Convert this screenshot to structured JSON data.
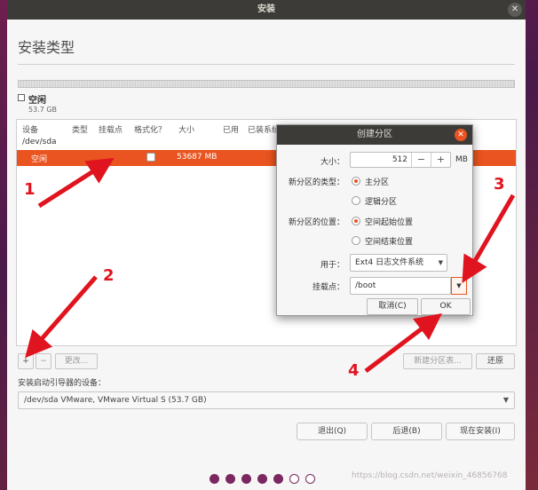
{
  "window": {
    "title": "安装",
    "close_glyph": "✕"
  },
  "page": {
    "title": "安装类型"
  },
  "legend": {
    "label": "空闲",
    "size": "53.7 GB"
  },
  "table": {
    "headers": [
      "设备",
      "类型",
      "挂载点",
      "格式化？",
      "大小",
      "已用",
      "已装系统"
    ],
    "device": "/dev/sda",
    "selected_row": {
      "name": "空闲",
      "size": "53687 MB"
    }
  },
  "toolbar": {
    "add": "+",
    "remove": "−",
    "change": "更改...",
    "new_table": "新建分区表...",
    "revert": "还原"
  },
  "bootloader": {
    "label": "安装启动引导器的设备：",
    "value": "/dev/sda VMware, VMware Virtual S (53.7 GB)"
  },
  "nav": {
    "quit": "退出(Q)",
    "back": "后退(B)",
    "install": "现在安装(I)"
  },
  "progress": {
    "total": 7,
    "filled": 5
  },
  "watermark": "https://blog.csdn.net/weixin_46856768",
  "dialog": {
    "title": "创建分区",
    "close_glyph": "✕",
    "size_label": "大小：",
    "size_value": "512",
    "size_unit": "MB",
    "minus": "−",
    "plus": "+",
    "type_label": "新分区的类型：",
    "type_primary": "主分区",
    "type_logical": "逻辑分区",
    "location_label": "新分区的位置：",
    "location_start": "空间起始位置",
    "location_end": "空间结束位置",
    "use_label": "用于：",
    "use_value": "Ext4 日志文件系统",
    "mount_label": "挂载点：",
    "mount_value": "/boot",
    "cancel": "取消(C)",
    "ok": "OK"
  },
  "annotations": {
    "n1": "1",
    "n2": "2",
    "n3": "3",
    "n4": "4",
    "color": "#e0141e"
  },
  "colors": {
    "accent": "#e95420",
    "titlebar": "#3c3b37",
    "dot": "#7b2760"
  }
}
